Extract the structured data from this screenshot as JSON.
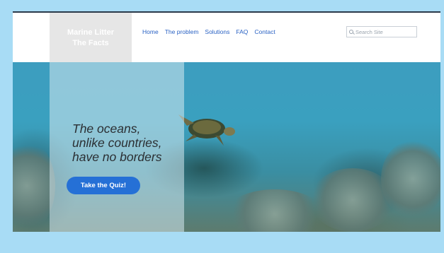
{
  "site": {
    "logo_line1": "Marine Litter",
    "logo_line2": "The Facts"
  },
  "nav": {
    "items": [
      {
        "label": "Home"
      },
      {
        "label": "The problem"
      },
      {
        "label": "Solutions"
      },
      {
        "label": "FAQ"
      },
      {
        "label": "Contact"
      }
    ]
  },
  "search": {
    "placeholder": "Search Site",
    "icon": "search-icon"
  },
  "hero": {
    "headline_line1": "The oceans,",
    "headline_line2": "unlike countries,",
    "headline_line3": "have no borders",
    "cta_label": "Take the Quiz!"
  },
  "colors": {
    "frame_bg": "#a8dcf5",
    "nav_link": "#2a62c4",
    "cta_bg": "#2570d6",
    "logo_box": "#e6e6e6"
  }
}
